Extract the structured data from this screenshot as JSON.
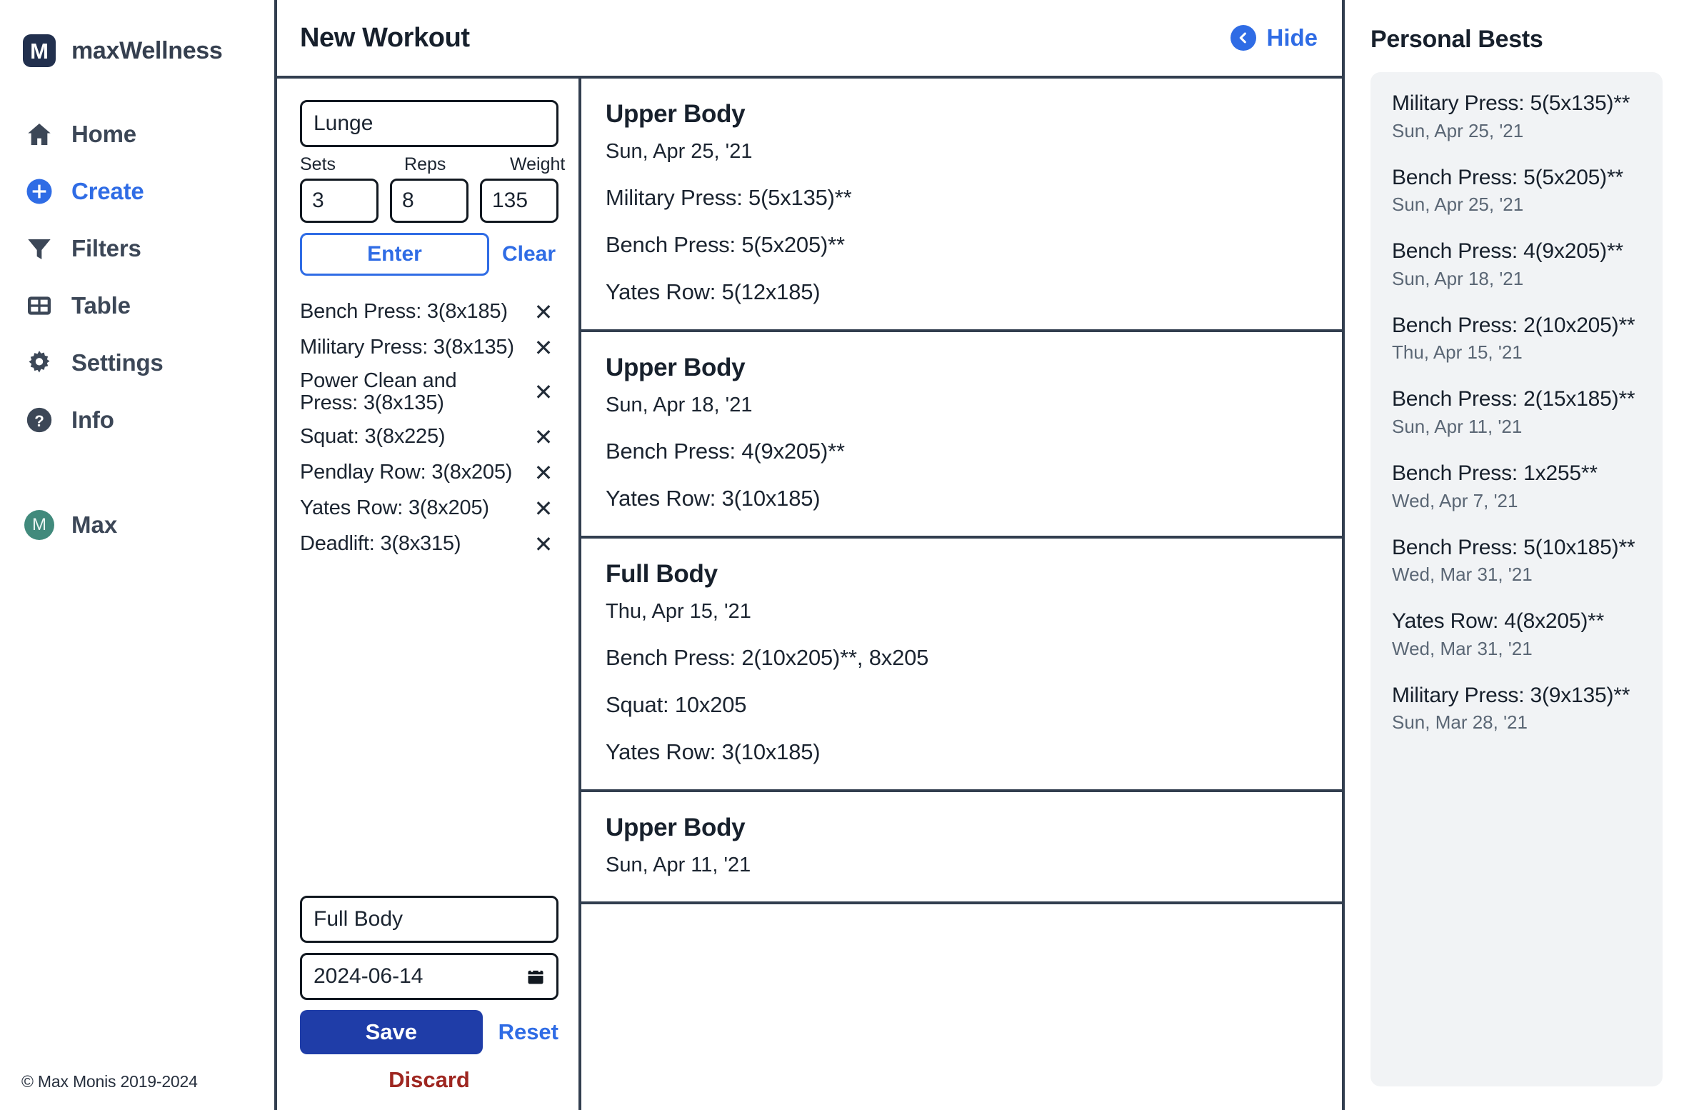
{
  "sidebar": {
    "brand": {
      "mark": "M",
      "mark_icon": "app-logo-icon",
      "name": "maxWellness"
    },
    "items": [
      {
        "label": "Home",
        "icon": "home-icon",
        "active": false
      },
      {
        "label": "Create",
        "icon": "plus-circle-icon",
        "active": true
      },
      {
        "label": "Filters",
        "icon": "funnel-icon",
        "active": false
      },
      {
        "label": "Table",
        "icon": "table-icon",
        "active": false
      },
      {
        "label": "Settings",
        "icon": "gear-icon",
        "active": false
      },
      {
        "label": "Info",
        "icon": "question-circle-icon",
        "active": false
      }
    ],
    "user": {
      "initial": "M",
      "name": "Max"
    },
    "copyright": "© Max Monis 2019-2024"
  },
  "center": {
    "title": "New Workout",
    "hide_label": "Hide",
    "hide_icon": "chevron-left-circle-icon"
  },
  "form": {
    "exercise_name": {
      "value": "Lunge",
      "placeholder": "Exercise Name"
    },
    "sets": {
      "label": "Sets",
      "value": "3",
      "placeholder": "0"
    },
    "reps": {
      "label": "Reps",
      "value": "8",
      "placeholder": "0"
    },
    "weight": {
      "label": "Weight",
      "value": "135",
      "placeholder": "0"
    },
    "enter_label": "Enter",
    "clear_label": "Clear",
    "entries": [
      "Bench Press: 3(8x185)",
      "Military Press: 3(8x135)",
      "Power Clean and Press: 3(8x135)",
      "Squat: 3(8x225)",
      "Pendlay Row: 3(8x205)",
      "Yates Row: 3(8x205)",
      "Deadlift: 3(8x315)"
    ],
    "remove_icon": "close-icon",
    "workout_name": {
      "value": "Full Body",
      "placeholder": "Workout Name"
    },
    "workout_date": {
      "value": "2024-06-14",
      "icon": "calendar-icon"
    },
    "save_label": "Save",
    "reset_label": "Reset",
    "discard_label": "Discard"
  },
  "history": [
    {
      "name": "Upper Body",
      "date": "Sun, Apr 25, '21",
      "lines": [
        "Military Press: 5(5x135)**",
        "Bench Press: 5(5x205)**",
        "Yates Row: 5(12x185)"
      ]
    },
    {
      "name": "Upper Body",
      "date": "Sun, Apr 18, '21",
      "lines": [
        "Bench Press: 4(9x205)**",
        "Yates Row: 3(10x185)"
      ]
    },
    {
      "name": "Full Body",
      "date": "Thu, Apr 15, '21",
      "lines": [
        "Bench Press: 2(10x205)**, 8x205",
        "Squat: 10x205",
        "Yates Row: 3(10x185)"
      ]
    },
    {
      "name": "Upper Body",
      "date": "Sun, Apr 11, '21",
      "lines": []
    }
  ],
  "personal_bests": {
    "title": "Personal Bests",
    "items": [
      {
        "label": "Military Press: 5(5x135)**",
        "date": "Sun, Apr 25, '21"
      },
      {
        "label": "Bench Press: 5(5x205)**",
        "date": "Sun, Apr 25, '21"
      },
      {
        "label": "Bench Press: 4(9x205)**",
        "date": "Sun, Apr 18, '21"
      },
      {
        "label": "Bench Press: 2(10x205)**",
        "date": "Thu, Apr 15, '21"
      },
      {
        "label": "Bench Press: 2(15x185)**",
        "date": "Sun, Apr 11, '21"
      },
      {
        "label": "Bench Press: 1x255**",
        "date": "Wed, Apr 7, '21"
      },
      {
        "label": "Bench Press: 5(10x185)**",
        "date": "Wed, Mar 31, '21"
      },
      {
        "label": "Yates Row: 4(8x205)**",
        "date": "Wed, Mar 31, '21"
      },
      {
        "label": "Military Press: 3(9x135)**",
        "date": "Sun, Mar 28, '21"
      }
    ]
  },
  "colors": {
    "accent_blue": "#2f6ce5",
    "save_blue": "#1f3da8",
    "discard_red": "#9e2620",
    "border_dark": "#323e4f",
    "logo_navy": "#22304e",
    "avatar_green": "#418a7c",
    "card_gray": "#f1f3f5"
  }
}
